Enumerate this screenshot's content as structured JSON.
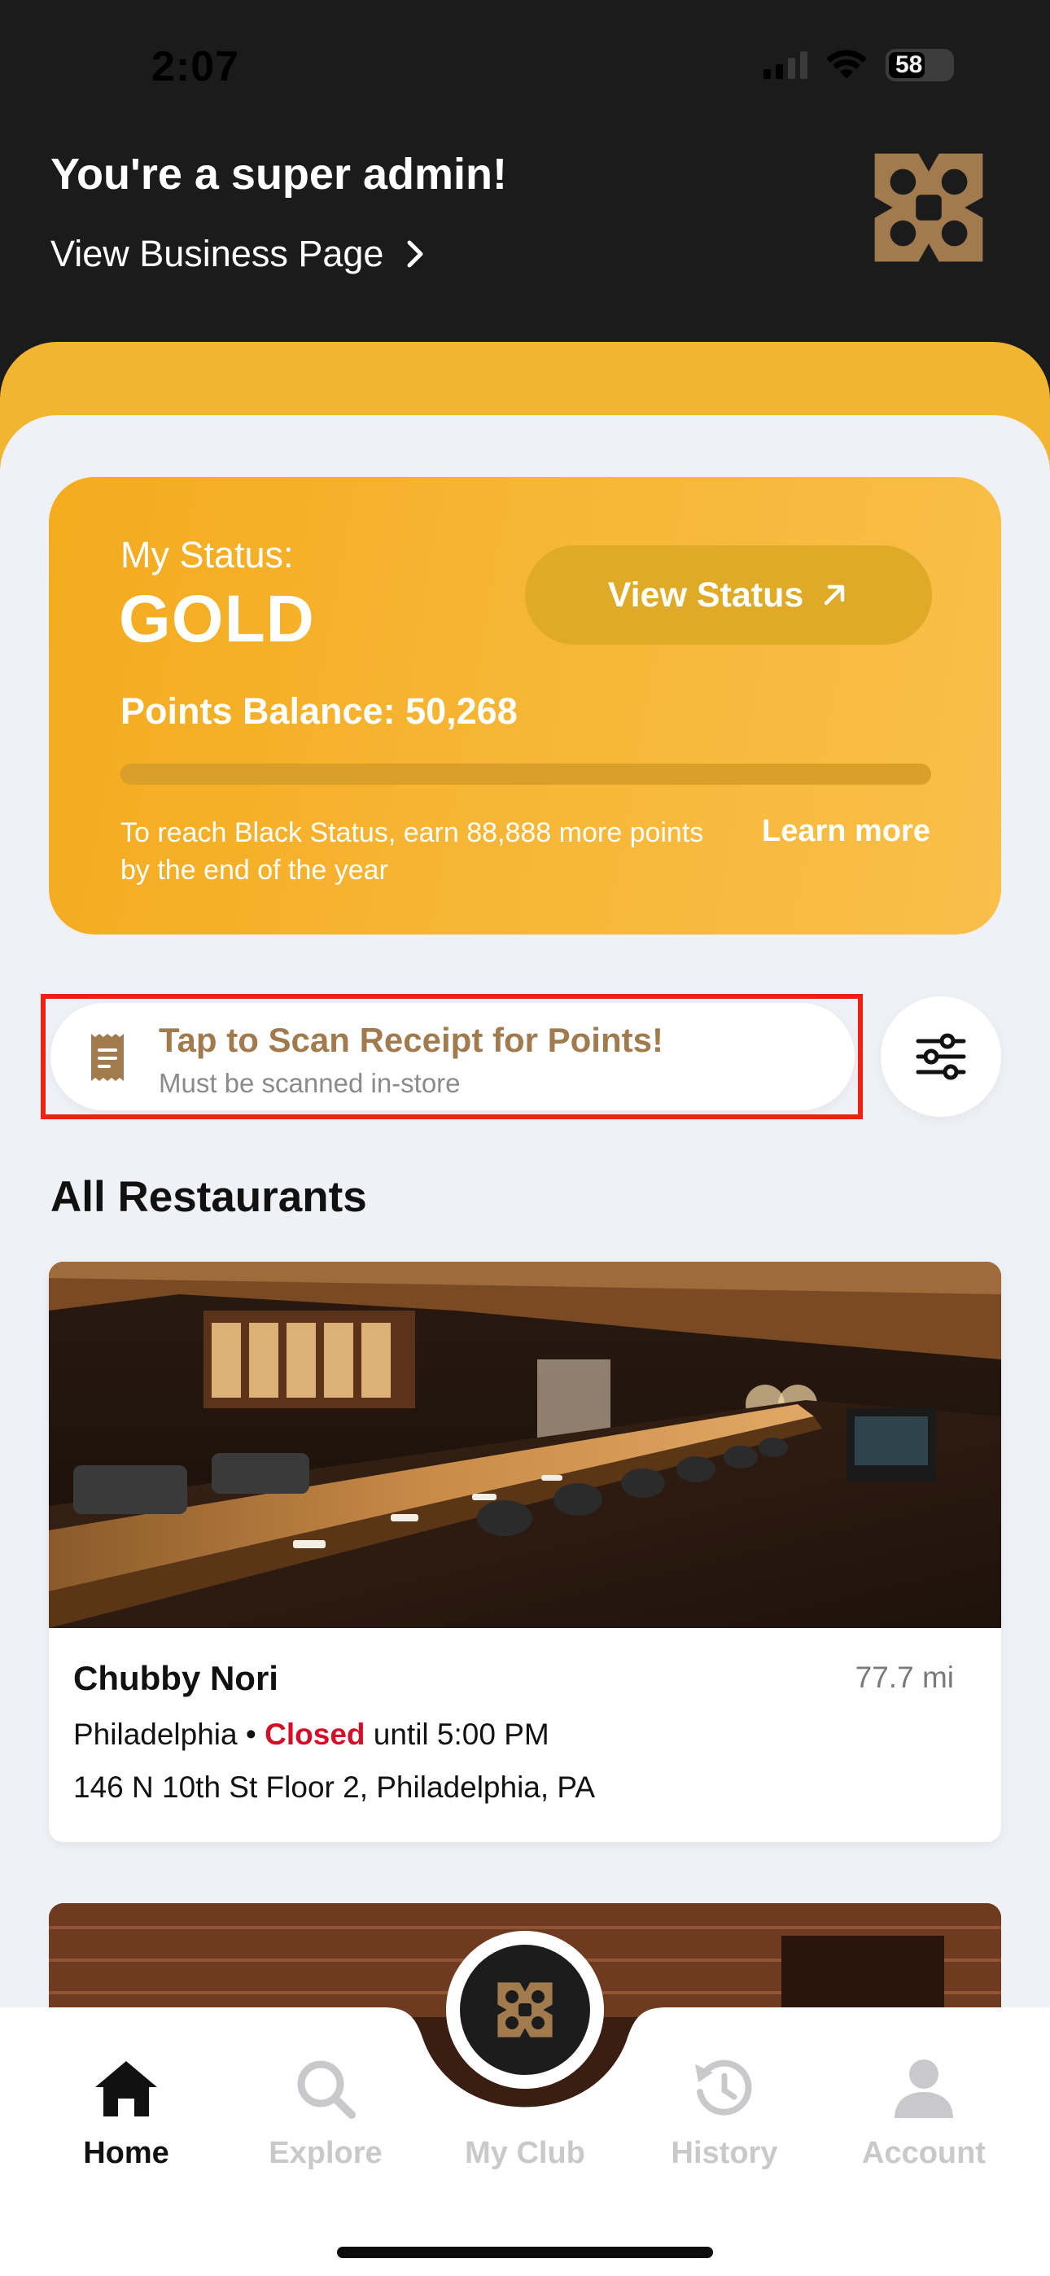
{
  "status_bar": {
    "time": "2:07",
    "battery": "58"
  },
  "header": {
    "title": "You're a super admin!",
    "business_link": "View Business Page"
  },
  "status_card": {
    "label": "My Status:",
    "tier": "GOLD",
    "view_status_button": "View Status",
    "points_balance": "Points Balance: 50,268",
    "progress_fraction": 0.0,
    "progress_note": "To reach Black Status, earn 88,888 more points by the end of the year",
    "learn_more": "Learn more"
  },
  "scan_receipt": {
    "title": "Tap to Scan Receipt for Points!",
    "subtitle": "Must be scanned in-store"
  },
  "restaurants": {
    "section_title": "All Restaurants",
    "items": [
      {
        "name": "Chubby Nori",
        "distance": "77.7 mi",
        "city": "Philadelphia",
        "separator": "•",
        "status": "Closed",
        "status_detail": "until 5:00 PM",
        "address": "146 N 10th St Floor 2, Philadelphia, PA"
      }
    ]
  },
  "bottom_nav": {
    "items": [
      {
        "label": "Home",
        "icon": "home-icon",
        "active": true
      },
      {
        "label": "Explore",
        "icon": "search-icon",
        "active": false
      },
      {
        "label": "My Club",
        "icon": "club-logo-icon",
        "active": false
      },
      {
        "label": "History",
        "icon": "history-icon",
        "active": false
      },
      {
        "label": "Account",
        "icon": "account-icon",
        "active": false
      }
    ]
  },
  "colors": {
    "header_bg": "#1b1b1b",
    "gold": "#f4ab1e",
    "brand_bronze": "#a17a4e",
    "closed_red": "#d20f29",
    "highlight_red": "#ee2212",
    "page_bg": "#eff1f6"
  }
}
